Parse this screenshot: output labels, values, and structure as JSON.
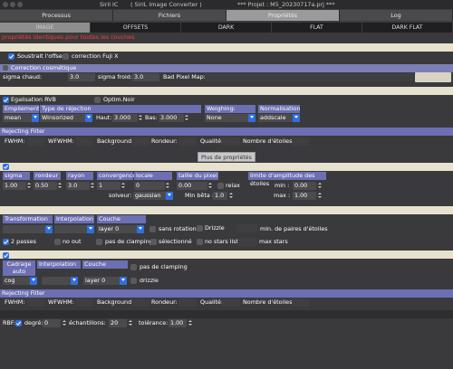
{
  "window": {
    "app_title": "Siril IC",
    "subtitle": "( SiriL Image Converter )",
    "project": "*** Projet : M5_20230717a.prj ***"
  },
  "top_tabs": [
    {
      "label": "Processus",
      "active": false
    },
    {
      "label": "Fichiers",
      "active": false
    },
    {
      "label": "Propriétés",
      "active": true
    },
    {
      "label": "Log",
      "active": false
    }
  ],
  "sub_tabs": [
    {
      "label": "IMAGE",
      "active": true
    },
    {
      "label": "OFFSETS",
      "active": false
    },
    {
      "label": "DARK",
      "active": false
    },
    {
      "label": "FLAT",
      "active": false
    },
    {
      "label": "DARK FLAT",
      "active": false
    }
  ],
  "message": "propriétés identiques pour toutes les couches",
  "offset": {
    "subtract_label": "Soustrait l'offset",
    "subtract_checked": true,
    "fuji_label": "correction Fuji X",
    "fuji_checked": false
  },
  "cosmetic": {
    "title": "Correction cosmétique",
    "sigma_hot_label": "sigma chaud:",
    "sigma_hot": "3.0",
    "sigma_cold_label": "sigma froid:",
    "sigma_cold": "3.0",
    "bad_pixel_label": "Bad Pixel Map:",
    "bad_pixel_value": ""
  },
  "stacking": {
    "rgb_label": "Egalisation RVB",
    "rgb_checked": true,
    "optim_label": "Optim.Noir",
    "optim_checked": false,
    "headers": {
      "stacking": "Empilement",
      "rejection": "Type de réjection",
      "weighing": "Weighing:",
      "normalisation": "Normalisation"
    },
    "stacking_value": "mean",
    "rejection_value": "Winsorized",
    "high_label": "Haut:",
    "high_value": "3.000",
    "low_label": "Bas:",
    "low_value": "3.000",
    "weighing_value": "None",
    "normalisation_value": "addscale"
  },
  "filter1": {
    "title": "Rejecting Filter",
    "fwhm": "FWHM:",
    "wfwhm": "WFWHM:",
    "background": "Background:",
    "roundness": "Rondeur:",
    "quality": "Qualité:",
    "stars": "Nombre d'étoiles:"
  },
  "tooltip": "Plus de propriétés",
  "detection": {
    "checked": true,
    "headers": {
      "sigma": "sigma",
      "roundness": "rondeur",
      "radius": "rayon",
      "convergence": "convergence",
      "local": "locale",
      "pixel_size": "taille du pixel",
      "amplitude": "limite d'amplitude des étoiles"
    },
    "sigma_value": "1.00",
    "roundness_value": "0.50",
    "radius_value": "3.0",
    "convergence_value": "1",
    "local_value": "0",
    "pixel_size_value": "0.00",
    "relax_label": "relax",
    "relax_checked": false,
    "min_label": "min :",
    "min_value": "0.00",
    "solver_label": "solveur:",
    "solver_value": "gaussian",
    "min_beta_label": "Min bêta :",
    "min_beta_value": "1.0",
    "max_label": "max :",
    "max_value": "1.00"
  },
  "registration": {
    "headers": {
      "transformation": "Transformation",
      "interpolation": "Interpolation",
      "layer": "Couche"
    },
    "layer_value": "layer 0",
    "no_rotation_label": "sans rotation",
    "no_rotation_checked": false,
    "drizzle_label": "Drizzle",
    "drizzle_checked": false,
    "min_pairs_label": "min. de paires d'étoiles",
    "two_pass_label": "2 passes",
    "two_pass_checked": true,
    "no_out_label": "no out",
    "no_out_checked": false,
    "no_clamp_label": "pas de clamping",
    "no_clamp_checked": false,
    "selected_label": "sélectionné",
    "selected_checked": false,
    "no_stars_label": "no stars list",
    "no_stars_checked": false,
    "max_stars_label": "max  stars"
  },
  "framing": {
    "checked": true,
    "frame_header": "Cadrage",
    "auto_label": "auto",
    "interp_header": "Interpolation",
    "layer_header": "Couche",
    "no_clamp_label": "pas de clamping",
    "no_clamp_checked": false,
    "cog_value": "cog",
    "layer_value": "layer 0",
    "drizzle_label": "drizzle",
    "drizzle_checked": false
  },
  "filter2": {
    "title": "Rejecting Filter",
    "fwhm": "FWHM:",
    "wfwhm": "WFWHM:",
    "background": "Background:",
    "roundness": "Rondeur:",
    "quality": "Qualité:",
    "stars": "Nombre d'étoiles:"
  },
  "rbf": {
    "label": "RBF:",
    "degree_label": "degré:",
    "degree_checked": true,
    "degree_value": "0",
    "samples_label": "échantillons:",
    "samples_value": "20",
    "tolerance_label": "tolérance:",
    "tolerance_value": "1.00"
  },
  "colors": {
    "accent": "#2f6fe0",
    "header": "#6c6fb3",
    "section": "#e7e1cf",
    "warning": "#ff3b2f"
  }
}
